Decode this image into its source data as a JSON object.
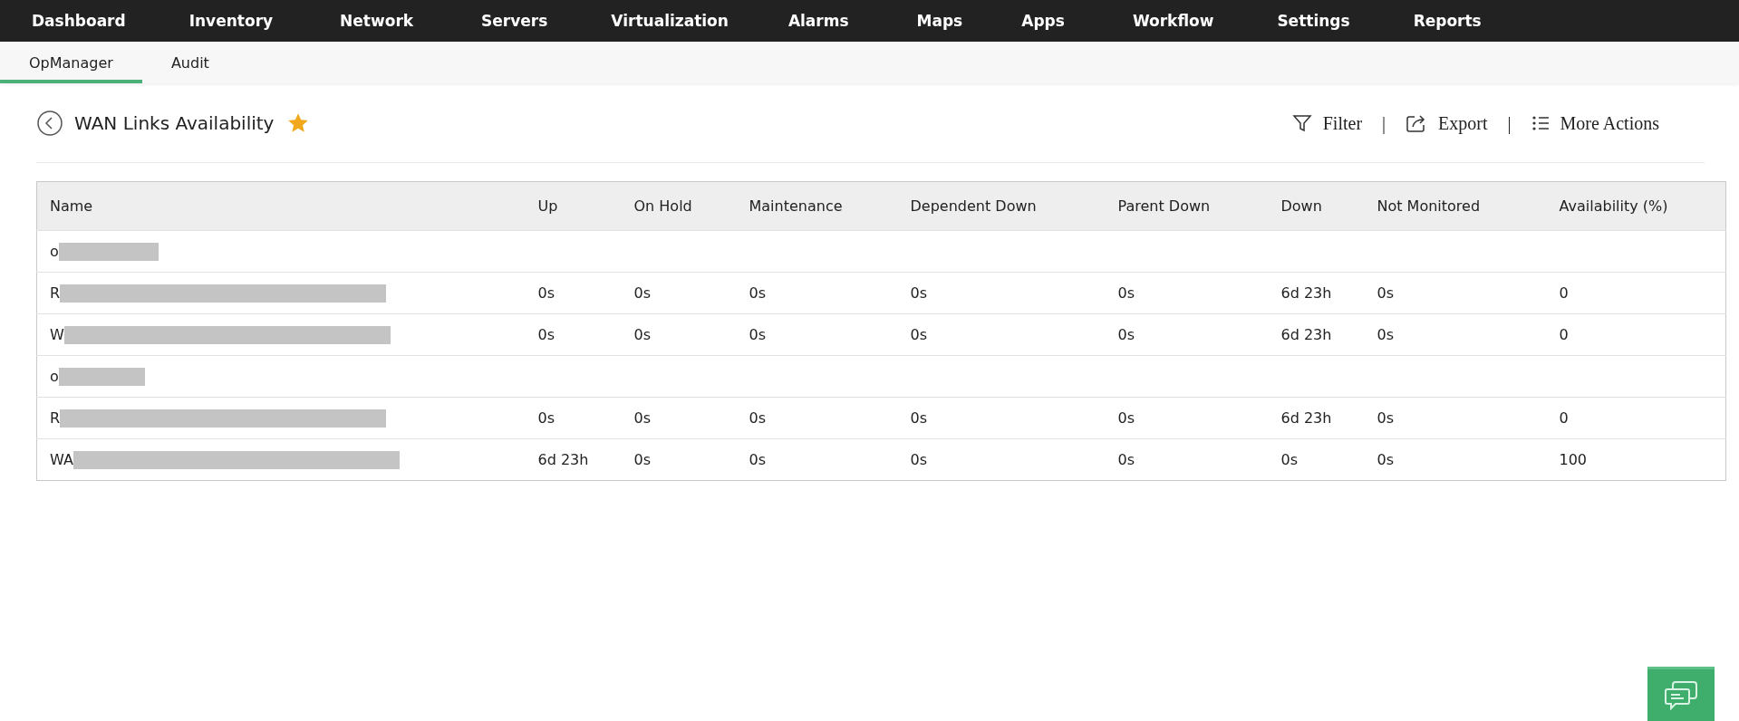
{
  "top_nav": [
    {
      "label": "Dashboard",
      "selected": false
    },
    {
      "label": "Inventory",
      "selected": false
    },
    {
      "label": "Network",
      "selected": false
    },
    {
      "label": "Servers",
      "selected": false
    },
    {
      "label": "Virtualization",
      "selected": false
    },
    {
      "label": "Alarms",
      "selected": false
    },
    {
      "label": "Maps",
      "selected": false
    },
    {
      "label": "Apps",
      "selected": false
    },
    {
      "label": "Workflow",
      "selected": false
    },
    {
      "label": "Settings",
      "selected": false
    },
    {
      "label": "Reports",
      "selected": false
    }
  ],
  "sub_tabs": [
    {
      "label": "OpManager",
      "selected": true
    },
    {
      "label": "Audit",
      "selected": false
    }
  ],
  "page": {
    "title": "WAN Links Availability",
    "favorite": true
  },
  "actions": [
    {
      "kind": "filter",
      "label": "Filter"
    },
    {
      "kind": "separator",
      "label": "|"
    },
    {
      "kind": "export",
      "label": "Export"
    },
    {
      "kind": "separator",
      "label": "|"
    },
    {
      "kind": "more",
      "label": "More Actions"
    }
  ],
  "table": {
    "columns": [
      "Name",
      "Up",
      "On Hold",
      "Maintenance",
      "Dependent Down",
      "Parent Down",
      "Down",
      "Not Monitored",
      "Availability (%)"
    ],
    "rows": [
      {
        "kind": "group",
        "redacted": true,
        "cells": [
          "o"
        ]
      },
      {
        "kind": "link",
        "redacted": true,
        "cells": [
          "R",
          "0s",
          "0s",
          "0s",
          "0s",
          "0s",
          "6d 23h",
          "0s",
          "0"
        ]
      },
      {
        "kind": "link",
        "redacted": true,
        "cells": [
          "W",
          "0s",
          "0s",
          "0s",
          "0s",
          "0s",
          "6d 23h",
          "0s",
          "0"
        ]
      },
      {
        "kind": "group",
        "redacted": true,
        "cells": [
          "o"
        ]
      },
      {
        "kind": "link",
        "redacted": true,
        "cells": [
          "R",
          "0s",
          "0s",
          "0s",
          "0s",
          "0s",
          "6d 23h",
          "0s",
          "0"
        ]
      },
      {
        "kind": "link",
        "redacted": true,
        "cells": [
          "WA",
          "6d 23h",
          "0s",
          "0s",
          "0s",
          "0s",
          "0s",
          "0s",
          "100"
        ]
      }
    ]
  }
}
